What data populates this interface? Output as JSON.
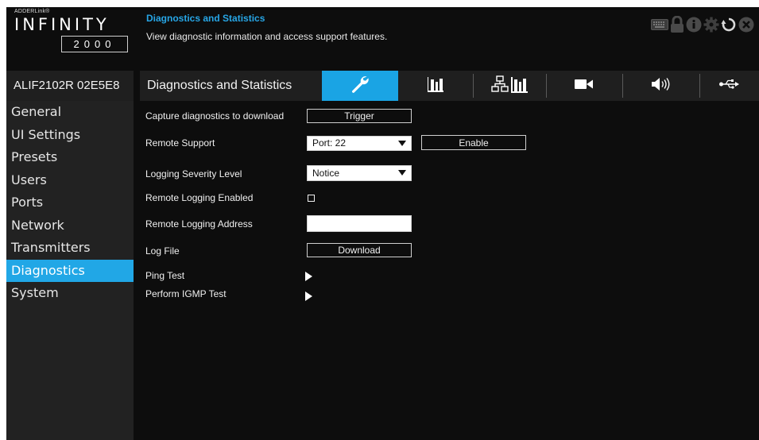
{
  "brand": {
    "small": "ADDERLink®",
    "name": "INFINITY",
    "model": "2000"
  },
  "header": {
    "title": "Diagnostics and Statistics",
    "description": "View diagnostic information and access support features."
  },
  "status_icons": [
    "keyboard-icon",
    "lock-icon",
    "info-icon",
    "settings-icon",
    "refresh-icon",
    "close-icon"
  ],
  "device_id": "ALIF2102R 02E5E8",
  "tabbar": {
    "title": "Diagnostics and Statistics",
    "tabs": [
      {
        "icon": "wrench-icon",
        "active": true
      },
      {
        "icon": "bar-chart-icon",
        "active": false
      },
      {
        "icon": "network-stats-icon",
        "active": false
      },
      {
        "icon": "video-icon",
        "active": false
      },
      {
        "icon": "audio-icon",
        "active": false
      },
      {
        "icon": "usb-icon",
        "active": false
      }
    ]
  },
  "sidebar": {
    "items": [
      {
        "label": "General"
      },
      {
        "label": "UI Settings"
      },
      {
        "label": "Presets"
      },
      {
        "label": "Users"
      },
      {
        "label": "Ports"
      },
      {
        "label": "Network"
      },
      {
        "label": "Transmitters"
      },
      {
        "label": "Diagnostics",
        "active": true
      },
      {
        "label": "System"
      }
    ]
  },
  "content": {
    "capture_label": "Capture diagnostics to download",
    "trigger_button": "Trigger",
    "remote_support_label": "Remote Support",
    "remote_support_port": "Port: 22",
    "enable_button": "Enable",
    "logging_severity_label": "Logging Severity Level",
    "logging_severity_value": "Notice",
    "remote_logging_enabled_label": "Remote Logging Enabled",
    "remote_logging_enabled": false,
    "remote_logging_address_label": "Remote Logging Address",
    "remote_logging_address_value": "",
    "log_file_label": "Log File",
    "download_button": "Download",
    "ping_test_label": "Ping Test",
    "igmp_test_label": "Perform IGMP Test"
  },
  "colors": {
    "accent": "#1aa4e4",
    "background": "#0d0d0d",
    "sidebar": "#222222",
    "bar": "#1f1f1f"
  }
}
